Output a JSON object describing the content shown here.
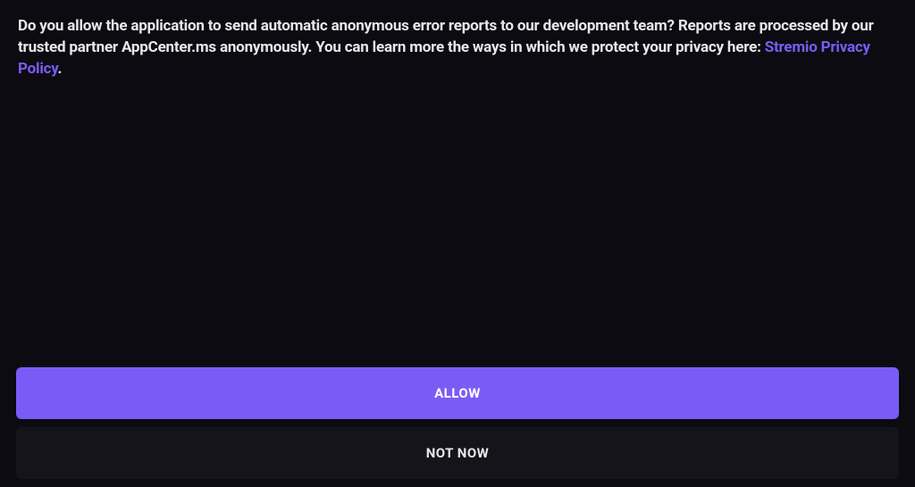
{
  "dialog": {
    "message_part1": "Do you allow the application to send automatic anonymous error reports to our development team? Reports are processed by our trusted partner AppCenter.ms anonymously. You can learn more the ways in which we protect your privacy here: ",
    "privacy_link_text": "Stremio Privacy Policy",
    "message_part2": "."
  },
  "buttons": {
    "allow_label": "ALLOW",
    "notnow_label": "NOT NOW"
  },
  "colors": {
    "accent": "#7b5bf5",
    "background": "#0c0b11"
  }
}
